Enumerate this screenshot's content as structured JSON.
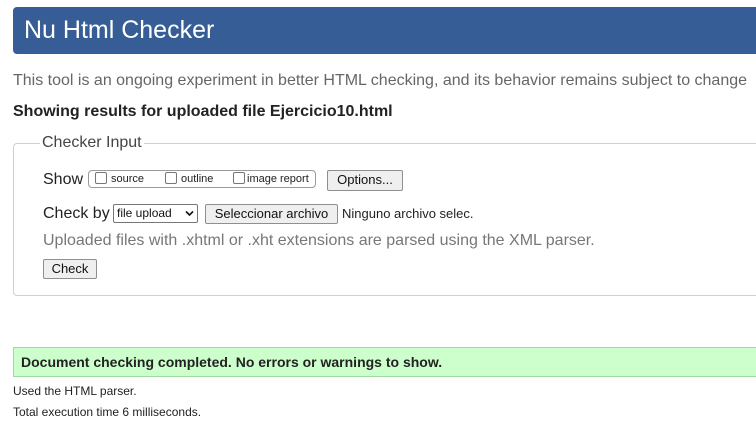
{
  "header": {
    "title": "Nu Html Checker"
  },
  "intro_text": "This tool is an ongoing experiment in better HTML checking, and its behavior remains subject to change",
  "results_heading": "Showing results for uploaded file Ejercicio10.html",
  "checker_input": {
    "legend": "Checker Input",
    "show_label": "Show",
    "checkboxes": [
      {
        "label": "source",
        "checked": false
      },
      {
        "label": "outline",
        "checked": false
      },
      {
        "label": "image report",
        "checked": false
      }
    ],
    "options_button": "Options...",
    "check_by_label": "Check by",
    "check_by_value": "file upload",
    "file_button": "Seleccionar archivo",
    "file_status": "Ninguno archivo selec.",
    "note": "Uploaded files with .xhtml or .xht extensions are parsed using the XML parser.",
    "check_button": "Check"
  },
  "result_message": "Document checking completed. No errors or warnings to show.",
  "parser_info": "Used the HTML parser.",
  "execution_time": "Total execution time 6 milliseconds.",
  "colors": {
    "header_bg": "#365d95",
    "success_bg": "#ccffcc"
  }
}
